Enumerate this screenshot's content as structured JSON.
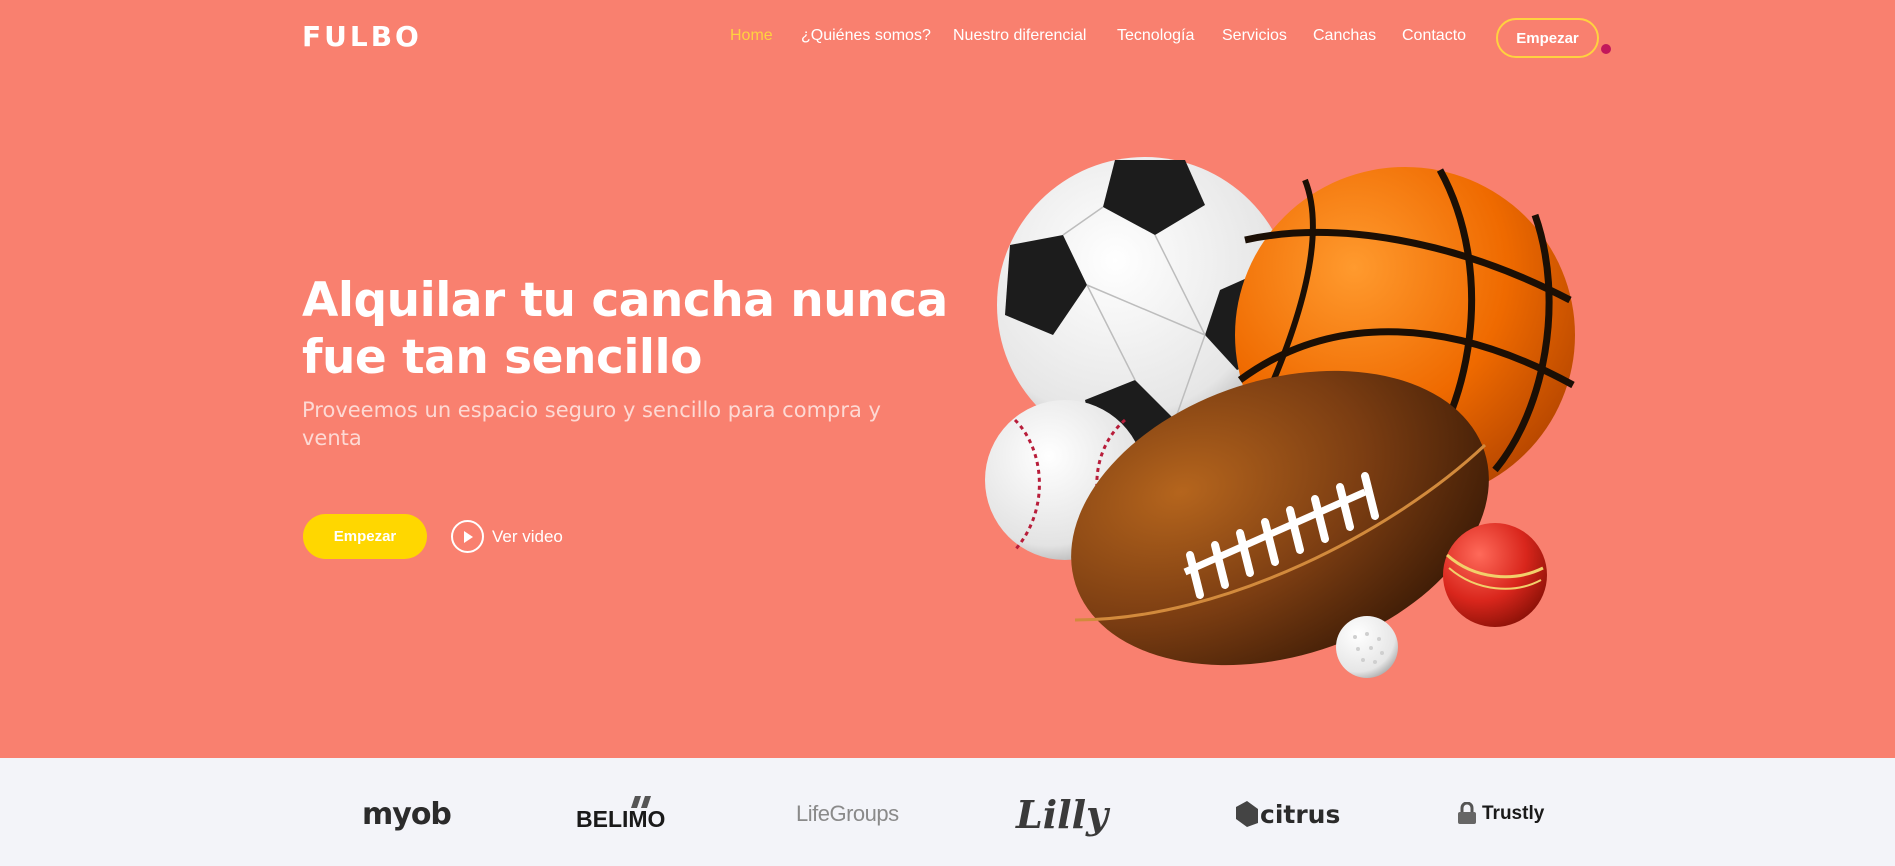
{
  "header": {
    "logo": "FULBO",
    "nav": [
      {
        "label": "Home",
        "active": true
      },
      {
        "label": "¿Quiénes somos?",
        "active": false
      },
      {
        "label": "Nuestro diferencial",
        "active": false
      },
      {
        "label": "Tecnología",
        "active": false
      },
      {
        "label": "Servicios",
        "active": false
      },
      {
        "label": "Canchas",
        "active": false
      },
      {
        "label": "Contacto",
        "active": false
      }
    ],
    "cta_label": "Empezar"
  },
  "hero": {
    "title": "Alquilar tu cancha nunca fue tan sencillo",
    "subtitle": "Proveemos un espacio seguro y sencillo para compra y venta",
    "primary_button": "Empezar",
    "video_link": "Ver video",
    "image_icons": [
      "soccer-ball-icon",
      "basketball-icon",
      "baseball-icon",
      "american-football-icon",
      "cricket-ball-icon",
      "golf-ball-icon"
    ]
  },
  "clients": {
    "logos": [
      "myob",
      "BELIMO",
      "LifeGroups",
      "Lilly",
      "citrus",
      "Trustly"
    ]
  },
  "colors": {
    "background": "#f9806f",
    "accent": "#ffd23f",
    "button": "#ffd700",
    "logo_strip": "#f3f4f9",
    "dot": "#c2185b"
  }
}
